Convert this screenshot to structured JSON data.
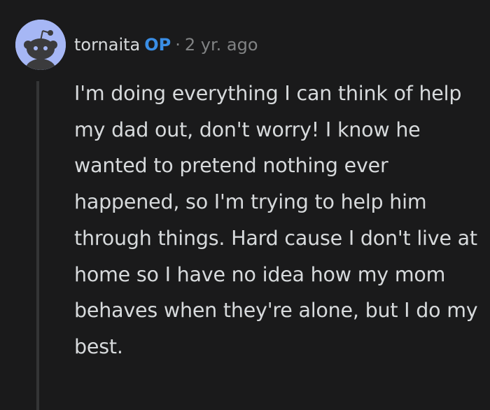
{
  "comment": {
    "author": "tornaita",
    "author_badge": "OP",
    "separator": "·",
    "timestamp": "2 yr. ago",
    "avatar_icon": "snoo-avatar-icon",
    "avatar_color": "#a6b7f5",
    "text": "I'm doing everything I can think of help my dad out, don't worry! I know he wanted to pretend nothing ever happened, so I'm trying to help him through things. Hard cause I don't live at home so I have no idea how my mom behaves when they're alone, but I do my best."
  },
  "colors": {
    "background": "#1a1a1b",
    "text": "#d7dadc",
    "muted": "#818384",
    "op_accent": "#3a8ee6",
    "thread_line": "#343536"
  }
}
